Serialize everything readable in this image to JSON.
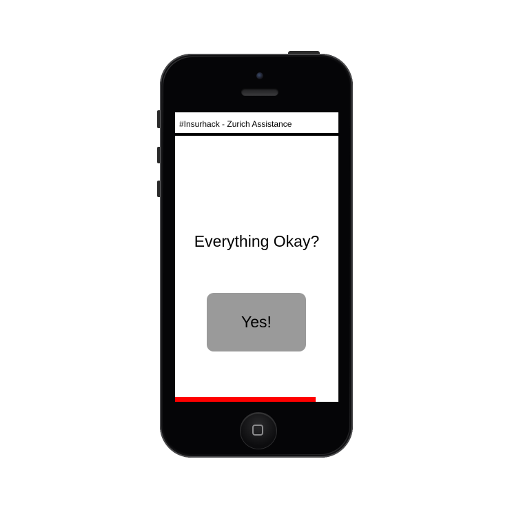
{
  "app": {
    "title": "#Insurhack - Zurich Assistance"
  },
  "main": {
    "question": "Everything Okay?",
    "confirm_label": "Yes!"
  },
  "countdown": {
    "progress_fraction": 0.86,
    "bar_color": "#ff0000"
  },
  "device": {
    "home_button_icon": "home-square-icon"
  }
}
